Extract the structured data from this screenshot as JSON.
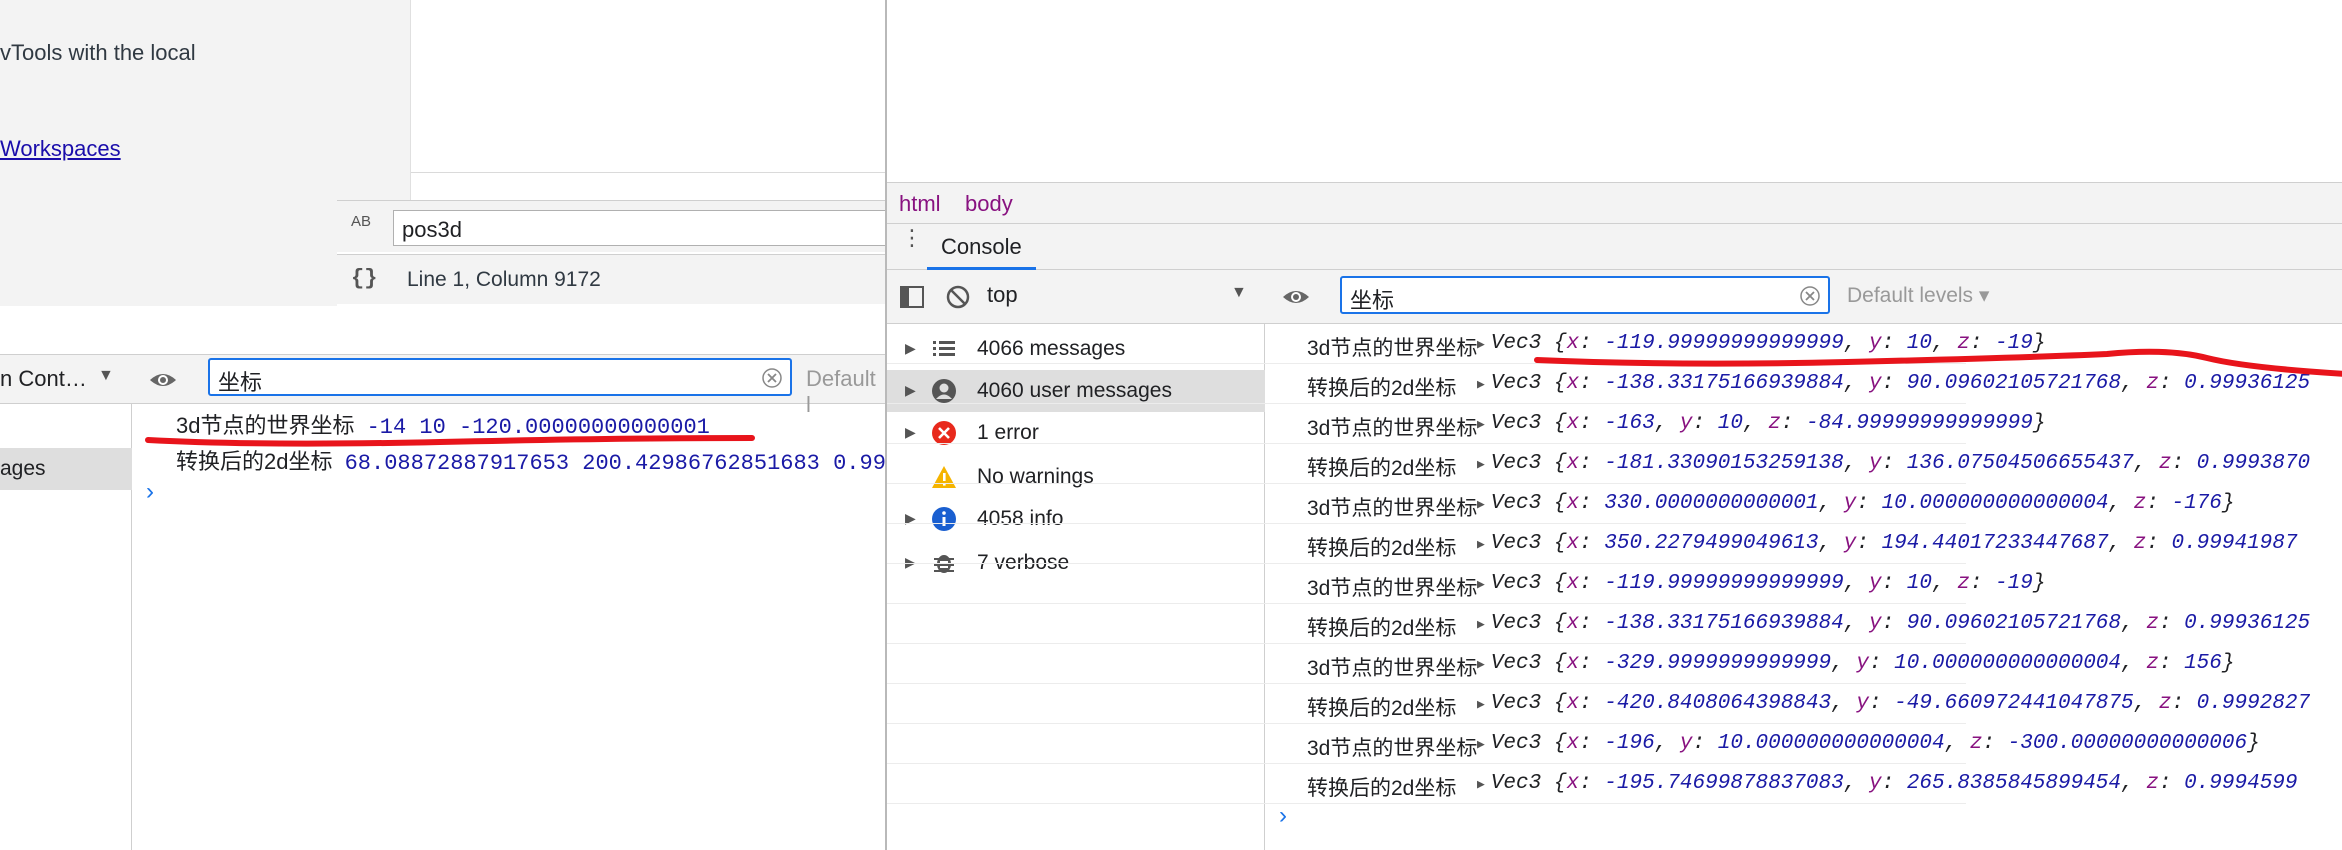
{
  "left": {
    "sidebar_text_line1": "vTools with the local",
    "sidebar_link": "Workspaces",
    "search_value": "pos3d",
    "search_icon_text": "AB",
    "status_text": "Line 1, Column 9172",
    "format_icon": "{}",
    "context_label": "n Cont…",
    "filter_value": "坐标",
    "default_levels_partial": "Default l",
    "sidebar_item": "ages",
    "log": [
      {
        "label": "3d节点的世界坐标",
        "values": "-14 10 -120.00000000000001"
      },
      {
        "label": "转换后的2d坐标",
        "values": "68.08872887917653 200.42986762851683 0.999"
      }
    ],
    "prompt": "›"
  },
  "right": {
    "breadcrumbs": [
      "html",
      "body"
    ],
    "drawer_tab": "Console",
    "context": "top",
    "filter_value": "坐标",
    "default_levels": "Default levels ▾",
    "sidebar": [
      {
        "label": "4066 messages",
        "icon": "list-icon",
        "expandable": true
      },
      {
        "label": "4060 user messages",
        "icon": "user-icon",
        "expandable": true,
        "selected": true
      },
      {
        "label": "1 error",
        "icon": "error-icon",
        "expandable": true
      },
      {
        "label": "No warnings",
        "icon": "warning-icon",
        "expandable": false
      },
      {
        "label": "4058 info",
        "icon": "info-icon",
        "expandable": true
      },
      {
        "label": "7 verbose",
        "icon": "bug-icon",
        "expandable": true
      }
    ],
    "logs": [
      {
        "label": "3d节点的世界坐标",
        "x": "-119.99999999999999",
        "y": "10",
        "z": "-19}",
        "trunc": false
      },
      {
        "label": "转换后的2d坐标",
        "x": "-138.33175166939884",
        "y": "90.09602105721768",
        "z": "0.99936125",
        "trunc": true
      },
      {
        "label": "3d节点的世界坐标",
        "x": "-163",
        "y": "10",
        "z": "-84.99999999999999}",
        "trunc": false
      },
      {
        "label": "转换后的2d坐标",
        "x": "-181.33090153259138",
        "y": "136.07504506655437",
        "z": "0.9993870",
        "trunc": true
      },
      {
        "label": "3d节点的世界坐标",
        "x": "330.0000000000001",
        "y": "10.000000000000004",
        "z": "-176}",
        "trunc": false
      },
      {
        "label": "转换后的2d坐标",
        "x": "350.2279499049613",
        "y": "194.44017233447687",
        "z": "0.99941987",
        "trunc": true
      },
      {
        "label": "3d节点的世界坐标",
        "x": "-119.99999999999999",
        "y": "10",
        "z": "-19}",
        "trunc": false
      },
      {
        "label": "转换后的2d坐标",
        "x": "-138.33175166939884",
        "y": "90.09602105721768",
        "z": "0.99936125",
        "trunc": true
      },
      {
        "label": "3d节点的世界坐标",
        "x": "-329.9999999999999",
        "y": "10.000000000000004",
        "z": "156}",
        "trunc": false
      },
      {
        "label": "转换后的2d坐标",
        "x": "-420.8408064398843",
        "y": "-49.660972441047875",
        "z": "0.9992827",
        "trunc": true
      },
      {
        "label": "3d节点的世界坐标",
        "x": "-196",
        "y": "10.000000000000004",
        "z": "-300.00000000000006}",
        "trunc": false
      },
      {
        "label": "转换后的2d坐标",
        "x": "-195.74699878837083",
        "y": "265.8385845899454",
        "z": "0.9994599",
        "trunc": true
      }
    ],
    "prompt": "›"
  },
  "colors": {
    "accent": "#1a73e8",
    "annotation": "#e8141b",
    "key": "#881280",
    "number": "#1a1aa6"
  }
}
